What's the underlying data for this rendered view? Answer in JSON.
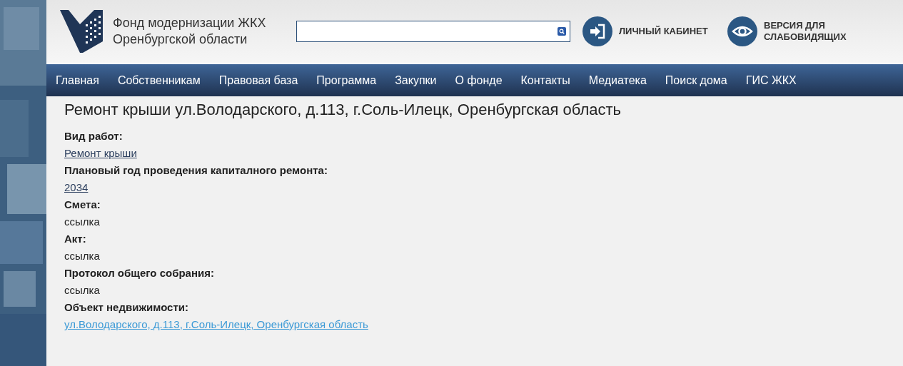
{
  "header": {
    "org_name": "Фонд модернизации ЖКХ",
    "org_region": "Оренбургской области",
    "account_link": "ЛИЧНЫЙ КАБИНЕТ",
    "accessibility_link": [
      "ВЕРСИЯ ДЛЯ",
      "СЛАБОВИДЯЩИХ"
    ]
  },
  "nav": [
    {
      "label": "Главная"
    },
    {
      "label": "Собственникам"
    },
    {
      "label": "Правовая база"
    },
    {
      "label": "Программа"
    },
    {
      "label": "Закупки"
    },
    {
      "label": "О фонде"
    },
    {
      "label": "Контакты"
    },
    {
      "label": "Медиатека"
    },
    {
      "label": "Поиск дома"
    },
    {
      "label": "ГИС ЖКХ"
    }
  ],
  "page_title": "Ремонт крыши ул.Володарского, д.113, г.Соль-Илецк, Оренбургская область",
  "fields": [
    {
      "label": "Вид работ:",
      "value": "Ремонт крыши",
      "kind": "link"
    },
    {
      "label": "Плановый год проведения капиталного ремонта:",
      "value": "2034",
      "kind": "link"
    },
    {
      "label": "Смета:",
      "value": "ссылка",
      "kind": "text"
    },
    {
      "label": "Акт:",
      "value": "ссылка",
      "kind": "text"
    },
    {
      "label": "Протокол общего собрания:",
      "value": "ссылка",
      "kind": "text"
    },
    {
      "label": "Объект недвижимости:",
      "value": "ул.Володарского, д.113, г.Соль-Илецк, Оренбургская область",
      "kind": "address-link"
    }
  ]
}
